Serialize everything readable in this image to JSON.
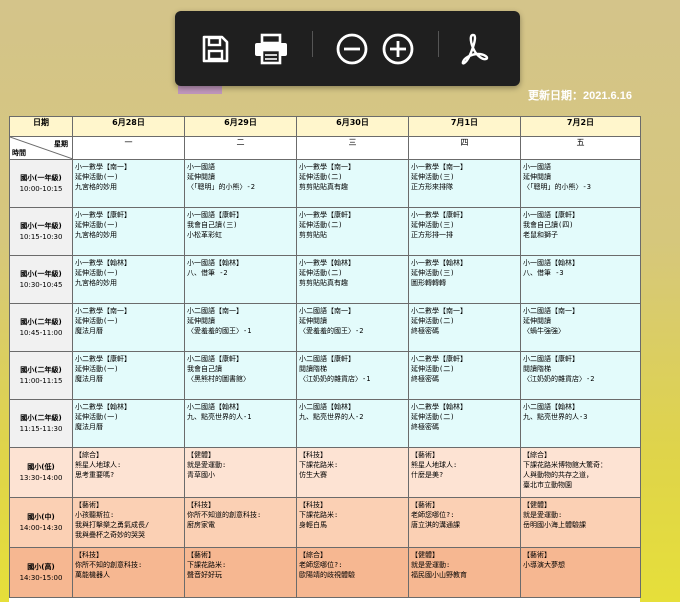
{
  "toolbar": {
    "save_icon": "save-icon",
    "print_icon": "print-icon",
    "zoom_out_icon": "zoom-out-icon",
    "zoom_in_icon": "zoom-in-icon",
    "pdf_icon": "pdf-icon"
  },
  "update_date": "更新日期：2021.6.16",
  "schedule": {
    "date_label": "日期",
    "weekday_label": "星期",
    "time_label": "時間",
    "dates": [
      "6月28日",
      "6月29日",
      "6月30日",
      "7月1日",
      "7月2日"
    ],
    "weekdays": [
      "一",
      "二",
      "三",
      "四",
      "五"
    ],
    "rows": [
      {
        "grade": "國小(一年級)",
        "time": "10:00-10:15",
        "color": "cyan",
        "cells": [
          [
            "小一數學【南一】",
            "延伸活動(一)",
            "九宮格的妙用"
          ],
          [
            "小一國語",
            "延伸閱讀",
            "〈「聰明」的小熊〉-2"
          ],
          [
            "小一數學【南一】",
            "延伸活動(二)",
            "剪剪貼貼真有趣"
          ],
          [
            "小一數學【南一】",
            "延伸活動(三)",
            "正方形來排隊"
          ],
          [
            "小一國語",
            "延伸閱讀",
            "〈「聰明」的小熊〉-3"
          ]
        ]
      },
      {
        "grade": "國小(一年級)",
        "time": "10:15-10:30",
        "color": "cyan",
        "cells": [
          [
            "小一數學【康軒】",
            "延伸活動(一)",
            "九宮格的妙用"
          ],
          [
            "小一國語【康軒】",
            "我會自己讀(三)",
            "小松革彩虹"
          ],
          [
            "小一數學【康軒】",
            "延伸活動(二)",
            "剪剪貼貼"
          ],
          [
            "小一數學【康軒】",
            "延伸活動(三)",
            "正方形排一排"
          ],
          [
            "小一國語【康軒】",
            "我會自己讀(四)",
            "老鼠和獅子"
          ]
        ]
      },
      {
        "grade": "國小(一年級)",
        "time": "10:30-10:45",
        "color": "cyan",
        "cells": [
          [
            "小一數學【翰林】",
            "延伸活動(一)",
            "九宮格的妙用"
          ],
          [
            "小一國語【翰林】",
            "八、借筆 -2"
          ],
          [
            "小一數學【翰林】",
            "延伸活動(二)",
            "剪剪貼貼真有趣"
          ],
          [
            "小一數學【翰林】",
            "延伸活動(三)",
            "圖形轉轉轉"
          ],
          [
            "小一國語【翰林】",
            "八、借筆 -3"
          ]
        ]
      },
      {
        "grade": "國小(二年級)",
        "time": "10:45-11:00",
        "color": "cyan",
        "cells": [
          [
            "小二數學【南一】",
            "延伸活動(一)",
            "魔法月曆"
          ],
          [
            "小二國語【南一】",
            "延伸閱讀",
            "〈愛羞羞的國王〉-1"
          ],
          [
            "小二國語【南一】",
            "延伸閱讀",
            "〈愛羞羞的國王〉-2"
          ],
          [
            "小二數學【南一】",
            "延伸活動(二)",
            "終極密碼"
          ],
          [
            "小二國語【南一】",
            "延伸閱讀",
            "〈蝸牛強強〉"
          ]
        ]
      },
      {
        "grade": "國小(二年級)",
        "time": "11:00-11:15",
        "color": "cyan",
        "cells": [
          [
            "小二數學【康軒】",
            "延伸活動(一)",
            "魔法月曆"
          ],
          [
            "小二國語【康軒】",
            "我會自己讀",
            "〈黑熊村的圖書館〉"
          ],
          [
            "小二國語【康軒】",
            "閱讀階梯",
            "〈江奶奶的雜貨店〉-1"
          ],
          [
            "小二數學【康軒】",
            "延伸活動(二)",
            "終極密碼"
          ],
          [
            "小二國語【康軒】",
            "閱讀階梯",
            "〈江奶奶的雜貨店〉-2"
          ]
        ]
      },
      {
        "grade": "國小(二年級)",
        "time": "11:15-11:30",
        "color": "cyan",
        "cells": [
          [
            "小二數學【翰林】",
            "延伸活動(一)",
            "魔法月曆"
          ],
          [
            "小二國語【翰林】",
            "九、點亮世界的人-1"
          ],
          [
            "小二國語【翰林】",
            "九、點亮世界的人-2"
          ],
          [
            "小二數學【翰林】",
            "延伸活動(二)",
            "終極密碼"
          ],
          [
            "小二國語【翰林】",
            "九、點亮世界的人-3"
          ]
        ]
      },
      {
        "grade": "國小(低)",
        "time": "13:30-14:00",
        "color": "pink",
        "cells": [
          [
            "【綜合】",
            "熊星人地球人:",
            "思考重要嗎?"
          ],
          [
            "【健體】",
            "就是愛運動:",
            "青草國小"
          ],
          [
            "【科技】",
            "下課花路米:",
            "仿生大賽"
          ],
          [
            "【藝術】",
            "熊星人地球人:",
            "什麼是美?"
          ],
          [
            "【綜合】",
            "下課花路米博物館大驚奇：",
            "人與動物的共存之道，",
            "臺北市立動物園"
          ]
        ]
      },
      {
        "grade": "國小(中)",
        "time": "14:00-14:30",
        "color": "salmon",
        "cells": [
          [
            "【藝術】",
            "小孩聽斯拉:",
            "我與打擊樂之勇氣成長/",
            "我與疊杯之奇妙的哭哭"
          ],
          [
            "【科技】",
            "你所不知道的創意科技:",
            "廚房家電"
          ],
          [
            "【科技】",
            "下課花路米:",
            "身輕白馬"
          ],
          [
            "【藝術】",
            "老師您哪位?:",
            "唐立淇的溝通課"
          ],
          [
            "【健體】",
            "就是愛運動:",
            "岳明國小海上體驗課"
          ]
        ]
      },
      {
        "grade": "國小(高)",
        "time": "14:30-15:00",
        "color": "orange",
        "cells": [
          [
            "【科技】",
            "你所不知的創意科技:",
            "萬能機器人"
          ],
          [
            "【藝術】",
            "下課花路米:",
            "聲音好好玩"
          ],
          [
            "【綜合】",
            "老師您哪位?:",
            "歐陽靖的歧視體驗"
          ],
          [
            "【健體】",
            "就是愛運動:",
            "福民國小山野教育"
          ],
          [
            "【藝術】",
            "小導演大夢想"
          ]
        ]
      }
    ]
  }
}
